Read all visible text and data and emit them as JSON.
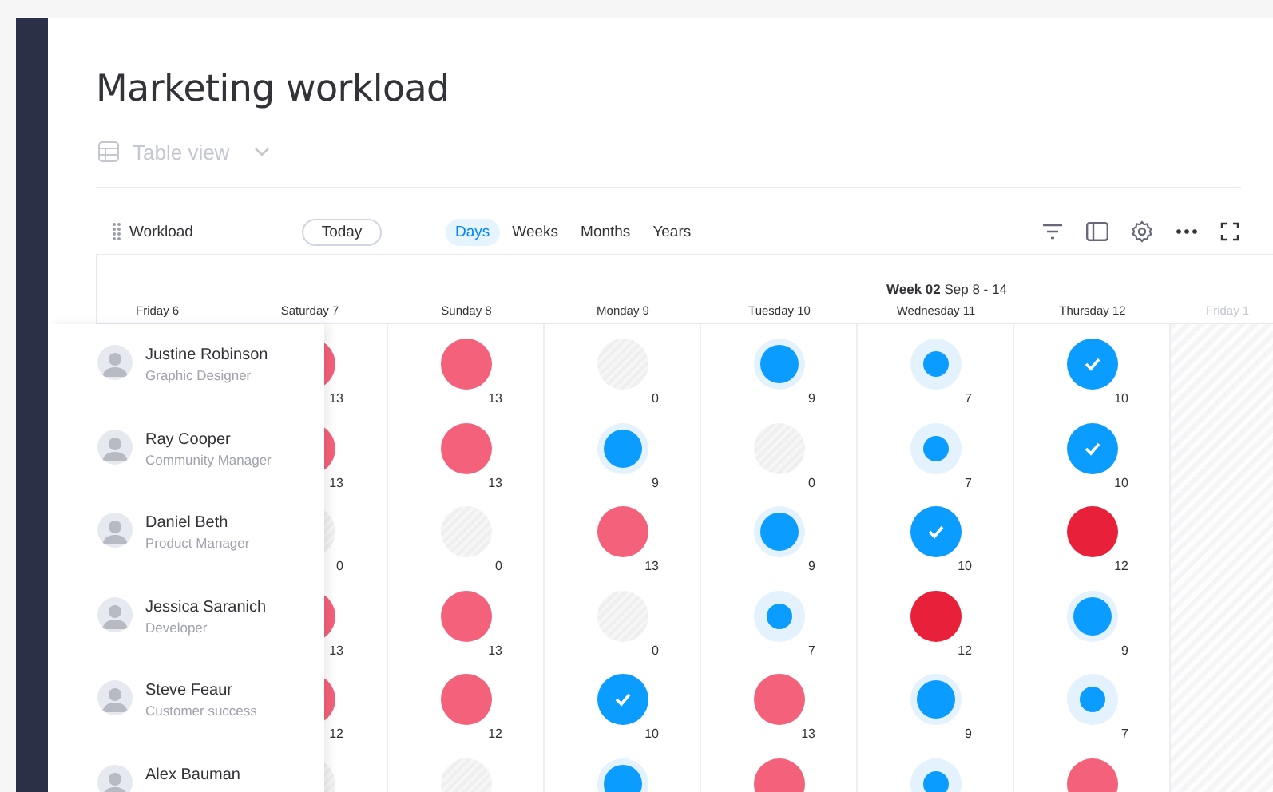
{
  "page": {
    "title": "Marketing workload"
  },
  "view_selector": {
    "label": "Table view"
  },
  "toolbar": {
    "widget_title": "Workload",
    "today_button": "Today",
    "scales": [
      {
        "label": "Days",
        "selected": true
      },
      {
        "label": "Weeks",
        "selected": false
      },
      {
        "label": "Months",
        "selected": false
      },
      {
        "label": "Years",
        "selected": false
      }
    ]
  },
  "timeline": {
    "week_label": "**Week 02** Sep 8 - 14",
    "days": [
      {
        "label": "Friday 6",
        "off": false
      },
      {
        "label": "Saturday 7",
        "off": false
      },
      {
        "label": "Sunday 8",
        "off": false
      },
      {
        "label": "Monday 9",
        "off": false
      },
      {
        "label": "Tuesday 10",
        "off": false
      },
      {
        "label": "Wednesday 11",
        "off": false
      },
      {
        "label": "Thursday 12",
        "off": false
      },
      {
        "label": "Friday 1",
        "off": true
      }
    ]
  },
  "people": [
    {
      "name": "Justine Robinson",
      "role": "Graphic Designer",
      "cells": [
        {
          "kind": "over",
          "count": "13"
        },
        {
          "kind": "over",
          "count": "13"
        },
        {
          "kind": "empty",
          "count": "0"
        },
        {
          "kind": "high",
          "count": "9"
        },
        {
          "kind": "low",
          "count": "7"
        },
        {
          "kind": "done",
          "count": "10"
        }
      ]
    },
    {
      "name": "Ray Cooper",
      "role": "Community Manager",
      "cells": [
        {
          "kind": "over",
          "count": "13"
        },
        {
          "kind": "over",
          "count": "13"
        },
        {
          "kind": "high",
          "count": "9"
        },
        {
          "kind": "empty",
          "count": "0"
        },
        {
          "kind": "low",
          "count": "7"
        },
        {
          "kind": "done",
          "count": "10"
        }
      ]
    },
    {
      "name": "Daniel Beth",
      "role": "Product Manager",
      "cells": [
        {
          "kind": "empty",
          "count": "0"
        },
        {
          "kind": "empty",
          "count": "0"
        },
        {
          "kind": "over",
          "count": "13"
        },
        {
          "kind": "high",
          "count": "9"
        },
        {
          "kind": "done",
          "count": "10"
        },
        {
          "kind": "critical",
          "count": "12"
        }
      ]
    },
    {
      "name": "Jessica Saranich",
      "role": "Developer",
      "cells": [
        {
          "kind": "over",
          "count": "13"
        },
        {
          "kind": "over",
          "count": "13"
        },
        {
          "kind": "empty",
          "count": "0"
        },
        {
          "kind": "low",
          "count": "7"
        },
        {
          "kind": "critical",
          "count": "12"
        },
        {
          "kind": "high",
          "count": "9"
        }
      ]
    },
    {
      "name": "Steve Feaur",
      "role": "Customer success",
      "cells": [
        {
          "kind": "over",
          "count": "12"
        },
        {
          "kind": "over",
          "count": "12"
        },
        {
          "kind": "done",
          "count": "10"
        },
        {
          "kind": "over",
          "count": "13"
        },
        {
          "kind": "high",
          "count": "9"
        },
        {
          "kind": "low",
          "count": "7"
        }
      ]
    },
    {
      "name": "Alex Bauman",
      "cells": [
        {
          "kind": "empty"
        },
        {
          "kind": "empty"
        },
        {
          "kind": "high"
        },
        {
          "kind": "over"
        },
        {
          "kind": "low"
        },
        {
          "kind": "over"
        }
      ]
    }
  ]
}
